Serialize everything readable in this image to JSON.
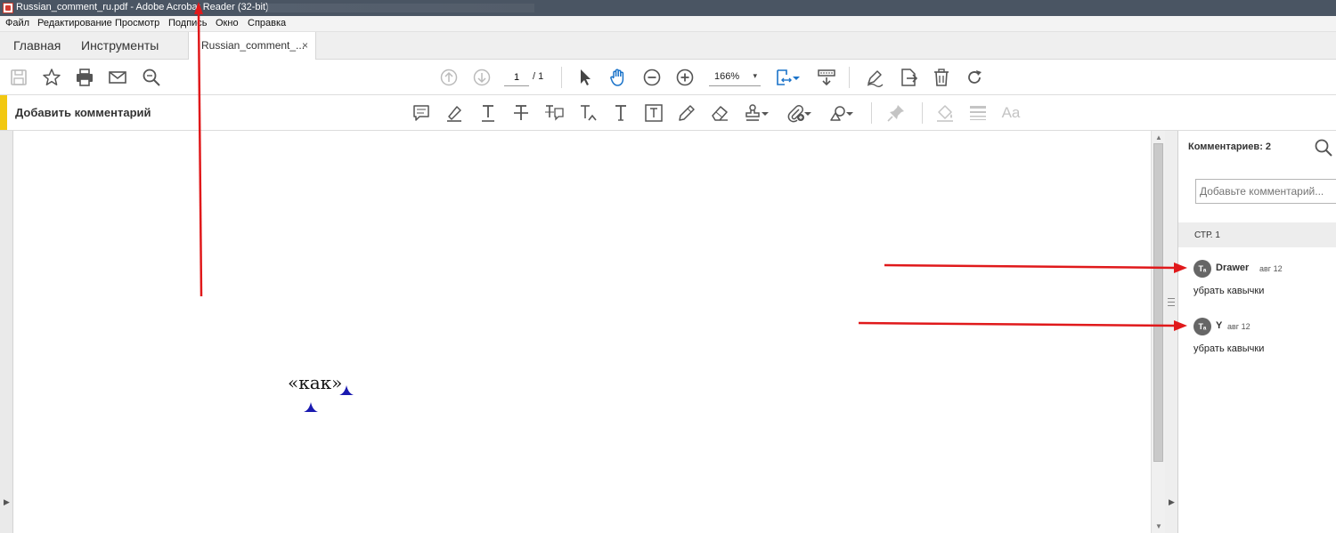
{
  "window": {
    "title": "Russian_comment_ru.pdf - Adobe Acrobat Reader (32-bit)"
  },
  "menu": [
    "Файл",
    "Редактирование",
    "Просмотр",
    "Подпись",
    "Окно",
    "Справка"
  ],
  "tabs": {
    "home": "Главная",
    "tools": "Инструменты",
    "document": "Russian_comment_...",
    "close_glyph": "×"
  },
  "toolbar": {
    "page_current": "1",
    "page_total": "/ 1",
    "zoom": "166%",
    "zoom_caret": "▾"
  },
  "comment_toolbar": {
    "label": "Добавить комментарий",
    "accent_color": "#f2c811",
    "aa_label": "Aa"
  },
  "document": {
    "text": "«как»",
    "marker_color": "#1a1ab0"
  },
  "comments_panel": {
    "title": "Комментариев: 2",
    "add_placeholder": "Добавьте комментарий...",
    "page_label": "СТР. 1",
    "items": [
      {
        "author": "Drawer",
        "date": "авг 12",
        "text": "убрать кавычки",
        "icon": "Tₐ"
      },
      {
        "author": "Y",
        "date": "авг 12",
        "text": "убрать кавычки",
        "icon": "Tₐ"
      }
    ]
  },
  "annotations": {
    "arrow_color": "#e0191b"
  }
}
